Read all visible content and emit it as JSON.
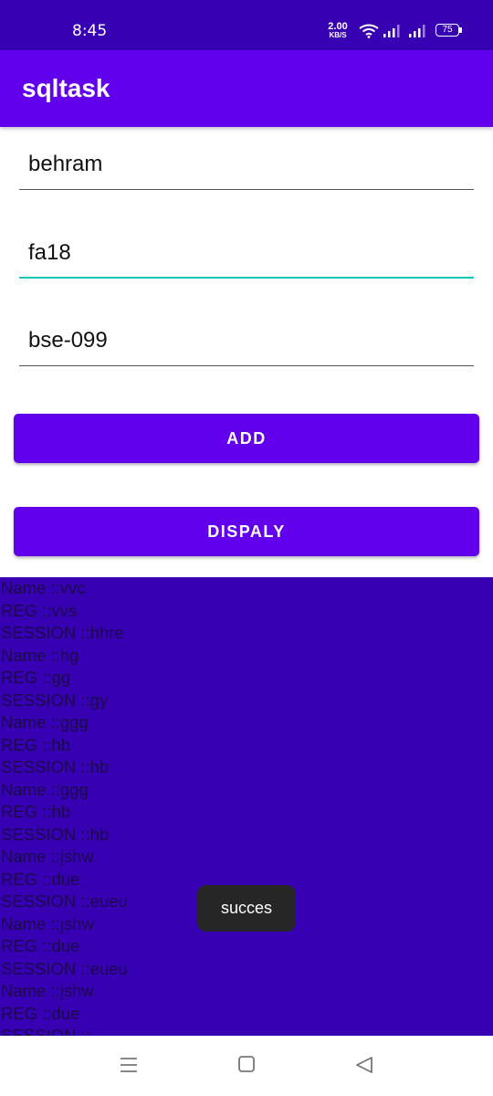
{
  "status_bar": {
    "time": "8:45",
    "net_speed_value": "2.00",
    "net_speed_unit": "KB/S",
    "battery_level": "75",
    "icons": [
      "wifi-icon",
      "signal-icon",
      "signal-icon",
      "battery-icon"
    ]
  },
  "app_bar": {
    "title": "sqltask"
  },
  "form": {
    "name_value": "behram",
    "session_value": "fa18",
    "reg_value": "bse-099"
  },
  "buttons": {
    "add_label": "ADD",
    "display_label": "DISPALY"
  },
  "records": [
    "Name ::vvc",
    "REG ::vvs",
    "SESSION ::hhre",
    "Name ::hg",
    "REG ::gg",
    "SESSION ::gy",
    "Name ::ggg",
    "REG ::hb",
    "SESSION ::hb",
    "Name ::ggg",
    "REG ::hb",
    "SESSION ::hb",
    "Name ::jshw",
    "REG ::due",
    "SESSION ::eueu",
    "Name ::jshw",
    "REG ::due",
    "SESSION ::eueu",
    "Name ::jshw",
    "REG ::due",
    "SESSION ::"
  ],
  "toast": {
    "message": "succes"
  },
  "nav_bar": {
    "icons": [
      "menu-icon",
      "home-icon",
      "back-icon"
    ]
  },
  "colors": {
    "status_bar": "#3700b3",
    "primary": "#6200ee",
    "records_bg": "#3700b3",
    "focus_accent": "#12c6c0"
  }
}
